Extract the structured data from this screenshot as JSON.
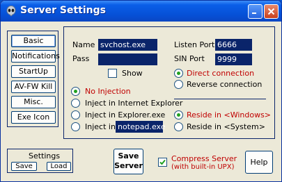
{
  "window": {
    "title": "Server Settings"
  },
  "nav": {
    "items": [
      {
        "label": "Basic"
      },
      {
        "label": "Notifications"
      },
      {
        "label": "StartUp"
      },
      {
        "label": "AV-FW Kill"
      },
      {
        "label": "Misc."
      },
      {
        "label": "Exe Icon"
      }
    ]
  },
  "main": {
    "name_label": "Name",
    "name_value": "svchost.exe",
    "pass_label": "Pass",
    "pass_value": "",
    "show_label": "Show",
    "listen_port_label": "Listen Port",
    "listen_port_value": "6666",
    "sin_port_label": "SIN Port",
    "sin_port_value": "9999",
    "connection": {
      "direct_label": "Direct connection",
      "reverse_label": "Reverse connection",
      "selected": "direct"
    },
    "injection": {
      "no_injection_label": "No Injection",
      "ie_label": "Inject in Internet Explorer",
      "explorer_label": "Inject in Explorer.exe",
      "inject_in_label": "Inject in",
      "inject_in_value": "notepad.exe",
      "selected": "none"
    },
    "reside": {
      "windows_label": "Reside in <Windows>",
      "system_label": "Reside in <System>",
      "selected": "windows"
    }
  },
  "settings": {
    "label": "Settings",
    "save_label": "Save",
    "load_label": "Load"
  },
  "save_server_line1": "Save",
  "save_server_line2": "Server",
  "compress": {
    "line1": "Compress Server",
    "line2": "(with built-in UPX)",
    "checked": true
  },
  "help_label": "Help",
  "colors": {
    "accent_text": "#c00000",
    "field_bg": "#0a246a",
    "selected_radio": "#21a121"
  }
}
